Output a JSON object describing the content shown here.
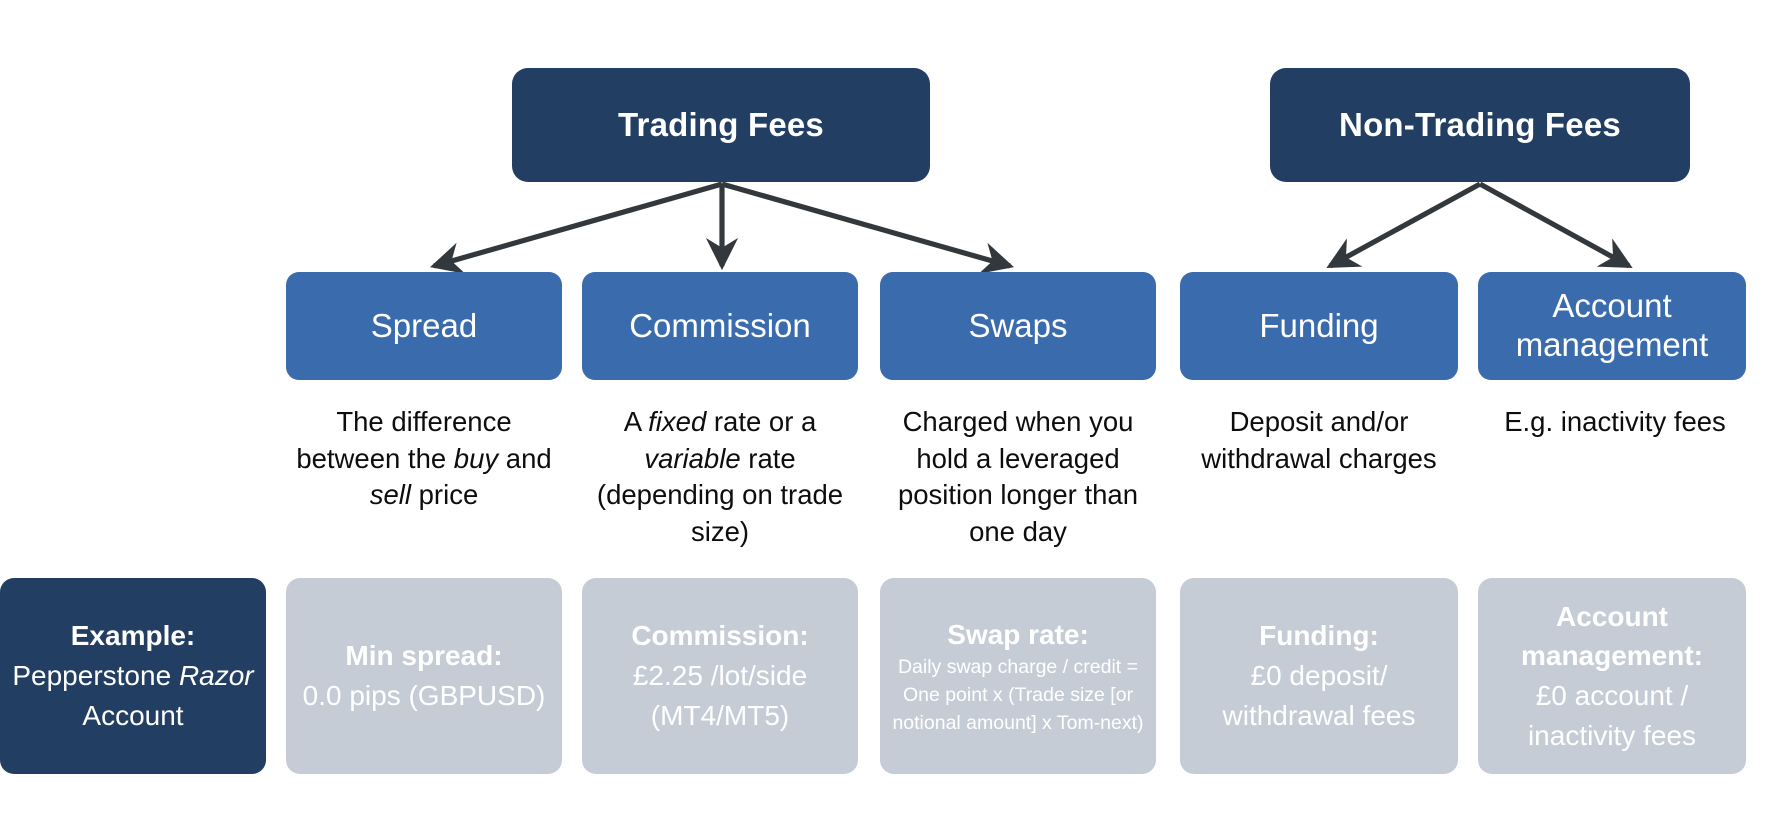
{
  "colors": {
    "navy": "#223F63",
    "blue": "#3A6CAD",
    "grey": "#C6CCD5",
    "arrow": "#33383D",
    "text": "#0d0d0d",
    "box_text": "#ffffff",
    "background": "#ffffff"
  },
  "headers": [
    {
      "label": "Trading Fees"
    },
    {
      "label": "Non-Trading Fees"
    }
  ],
  "categories": [
    {
      "label": "Spread"
    },
    {
      "label": "Commission"
    },
    {
      "label": "Swaps"
    },
    {
      "label": "Funding"
    },
    {
      "label": "Account management"
    }
  ],
  "descriptions": [
    {
      "html": "The difference between the <em>buy</em> and <em>sell</em> price"
    },
    {
      "html": "A <em>fixed</em> rate or a <em>variable</em> rate (depending on trade size)"
    },
    {
      "html": "Charged when you hold a leveraged position longer than one day"
    },
    {
      "html": "Deposit and/or withdrawal charges"
    },
    {
      "html": "E.g. inactivity fees"
    }
  ],
  "examples": [
    {
      "title": "Example:",
      "body_html": "Pepperstone <em>Razor</em> Account"
    },
    {
      "title": "Min spread:",
      "body_html": "0.0 pips (GBPUSD)"
    },
    {
      "title": "Commission:",
      "body_html": "£2.25 /lot/side (MT4/MT5)"
    },
    {
      "title": "Swap rate:",
      "body_html": "Daily swap charge / credit = One point x (Trade size [or notional amount] x Tom-next)"
    },
    {
      "title": "Funding:",
      "body_html": "£0 deposit/ withdrawal fees"
    },
    {
      "title": "Account management:",
      "body_html": "£0 account / inactivity fees"
    }
  ]
}
